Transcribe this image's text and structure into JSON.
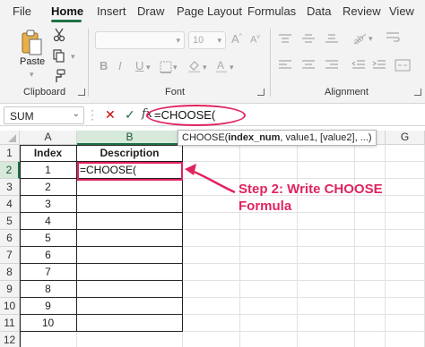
{
  "menu": {
    "tabs": [
      "File",
      "Home",
      "Insert",
      "Draw",
      "Page Layout",
      "Formulas",
      "Data",
      "Review",
      "View"
    ],
    "active": "Home"
  },
  "ribbon": {
    "clipboard": {
      "paste_label": "Paste",
      "group_label": "Clipboard"
    },
    "font": {
      "group_label": "Font",
      "size_value": "10",
      "bold": "B",
      "italic": "I",
      "underline": "U"
    },
    "alignment": {
      "group_label": "Alignment"
    }
  },
  "formula_bar": {
    "name_box": "SUM",
    "fx_label": "fx",
    "formula": "=CHOOSE("
  },
  "grid": {
    "columns": [
      "A",
      "B",
      "C",
      "D",
      "E",
      "F",
      "G"
    ],
    "rows": [
      "1",
      "2",
      "3",
      "4",
      "5",
      "6",
      "7",
      "8",
      "9",
      "10",
      "11",
      "12"
    ],
    "selected_column": "B",
    "selected_row": "2",
    "headers": {
      "a1": "Index",
      "b1": "Description"
    },
    "index_values": [
      "1",
      "2",
      "3",
      "4",
      "5",
      "6",
      "7",
      "8",
      "9",
      "10"
    ],
    "active_cell_text": "=CHOOSE("
  },
  "tooltip": {
    "prefix": "CHOOSE(",
    "bold_arg": "index_num",
    "rest": ", value1, [value2], ...)"
  },
  "annotation": {
    "line1": "Step 2: Write CHOOSE",
    "line2": "Formula",
    "color": "#e0245e"
  },
  "colors": {
    "accent_green": "#1e7145",
    "highlight": "#e0245e"
  }
}
